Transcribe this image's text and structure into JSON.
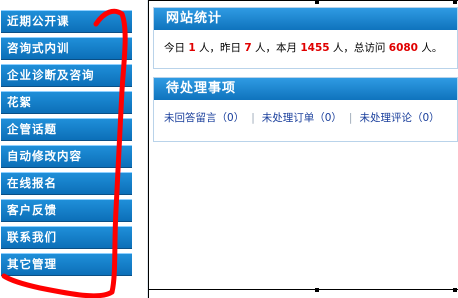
{
  "sidebar": {
    "items": [
      {
        "label": "近期公开课"
      },
      {
        "label": "咨询式内训"
      },
      {
        "label": "企业诊断及咨询"
      },
      {
        "label": "花絮"
      },
      {
        "label": "企管话题"
      },
      {
        "label": "自动修改内容"
      },
      {
        "label": "在线报名"
      },
      {
        "label": "客户反馈"
      },
      {
        "label": "联系我们"
      },
      {
        "label": "其它管理"
      }
    ]
  },
  "stats": {
    "title": "网站统计",
    "today_prefix": "今日",
    "today_value": "1",
    "today_unit": "人，",
    "yesterday_prefix": "昨日",
    "yesterday_value": "7",
    "yesterday_unit": "人，",
    "month_prefix": "本月",
    "month_value": "1455",
    "month_unit": "人，",
    "total_prefix": "总访问",
    "total_value": "6080",
    "total_unit": "人。"
  },
  "todo": {
    "title": "待处理事项",
    "items": [
      {
        "label": "未回答留言",
        "count": "0"
      },
      {
        "label": "未处理订单",
        "count": "0"
      },
      {
        "label": "未处理评论",
        "count": "0"
      }
    ]
  },
  "colors": {
    "nav_blue": "#0c6fb8",
    "header_blue": "#1a84cc",
    "highlight_red": "#e00000",
    "annotation_red": "#ff0000"
  }
}
